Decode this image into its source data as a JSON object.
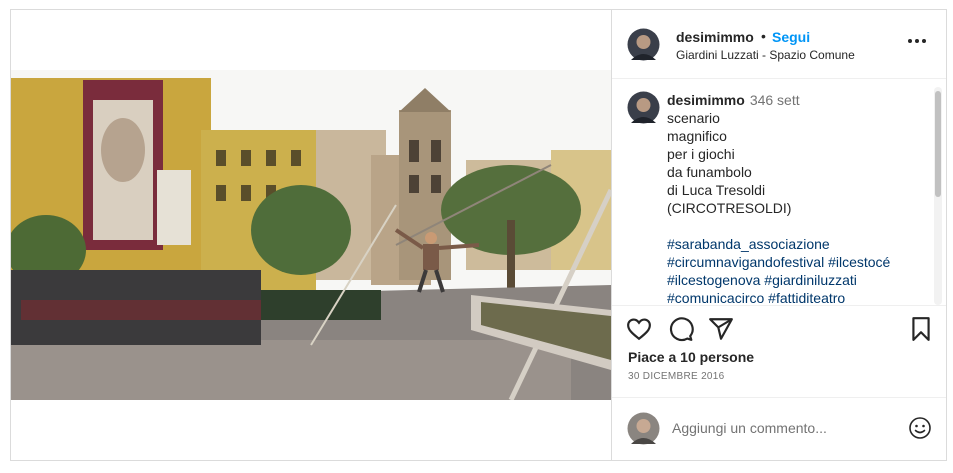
{
  "post": {
    "username": "desimimmo",
    "separator": "•",
    "follow_label": "Segui",
    "location": "Giardini Luzzati - Spazio Comune"
  },
  "caption": {
    "username": "desimimmo",
    "time": "346 sett",
    "lines": [
      "scenario",
      "magnifico",
      "per i giochi",
      "da funambolo",
      "di Luca Tresoldi",
      "(CIRCOTRESOLDI)"
    ],
    "tag_lines": [
      "#sarabanda_associazione",
      "#circumnavigandofestival #ilcestocé",
      "#ilcestogenova #giardiniluzzati",
      "#comunicacirco #fattiditeatro"
    ]
  },
  "actions": {
    "icons": [
      "heart-icon",
      "comment-icon",
      "share-icon",
      "bookmark-icon"
    ],
    "likes": "Piace a 10 persone",
    "date": "30 DICEMBRE 2016"
  },
  "comment": {
    "placeholder": "Aggiungi un commento...",
    "emoji_icon": "emoji-icon"
  },
  "colors": {
    "accent": "#0095f6",
    "hashtag": "#00376b",
    "muted": "#737373",
    "border": "#dbdbdb"
  }
}
